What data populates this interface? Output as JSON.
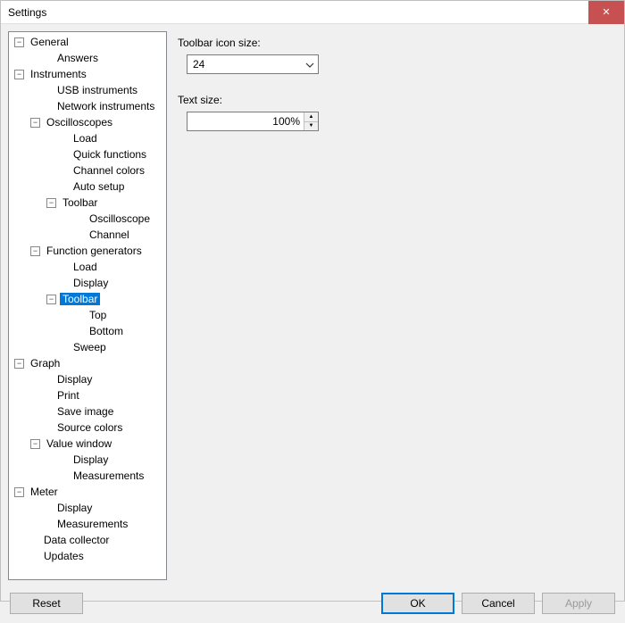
{
  "window_title": "Settings",
  "tree": {
    "general": "General",
    "answers": "Answers",
    "instruments": "Instruments",
    "usb_instruments": "USB instruments",
    "network_instruments": "Network instruments",
    "oscilloscopes": "Oscilloscopes",
    "osc_load": "Load",
    "osc_quick": "Quick functions",
    "osc_colors": "Channel colors",
    "osc_auto": "Auto setup",
    "osc_toolbar": "Toolbar",
    "osc_tb_osc": "Oscilloscope",
    "osc_tb_channel": "Channel",
    "func_gen": "Function generators",
    "fg_load": "Load",
    "fg_display": "Display",
    "fg_toolbar": "Toolbar",
    "fg_tb_top": "Top",
    "fg_tb_bottom": "Bottom",
    "fg_sweep": "Sweep",
    "graph": "Graph",
    "g_display": "Display",
    "g_print": "Print",
    "g_save": "Save image",
    "g_source": "Source colors",
    "g_value": "Value window",
    "g_vw_display": "Display",
    "g_vw_meas": "Measurements",
    "meter": "Meter",
    "m_display": "Display",
    "m_meas": "Measurements",
    "data_collector": "Data collector",
    "updates": "Updates"
  },
  "content": {
    "toolbar_icon_size_label": "Toolbar icon size:",
    "toolbar_icon_size_value": "24",
    "text_size_label": "Text size:",
    "text_size_value": "100%"
  },
  "buttons": {
    "reset": "Reset",
    "ok": "OK",
    "cancel": "Cancel",
    "apply": "Apply"
  }
}
